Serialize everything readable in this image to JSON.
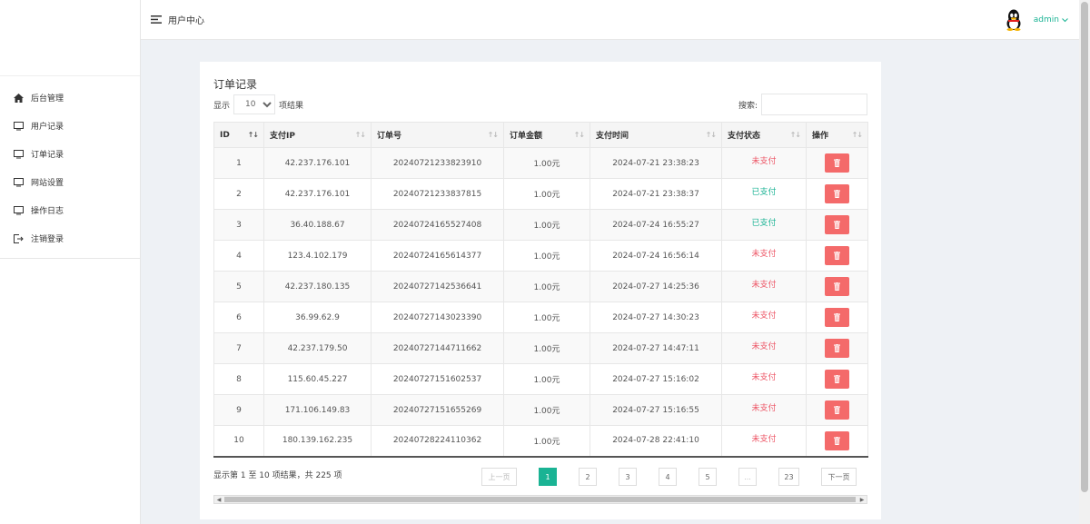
{
  "sidebar": {
    "items": [
      {
        "label": "后台管理",
        "icon": "home-icon"
      },
      {
        "label": "用户记录",
        "icon": "monitor-icon"
      },
      {
        "label": "订单记录",
        "icon": "monitor-icon"
      },
      {
        "label": "网站设置",
        "icon": "monitor-icon"
      },
      {
        "label": "操作日志",
        "icon": "monitor-icon"
      },
      {
        "label": "注销登录",
        "icon": "logout-icon"
      }
    ]
  },
  "header": {
    "title": "用户中心",
    "username": "admin",
    "avatar_icon": "qq-penguin-icon",
    "accent_color": "#1ab394"
  },
  "card": {
    "title": "订单记录",
    "length_prefix": "显示",
    "length_value": "10",
    "length_suffix": "项结果",
    "search_label": "搜索:",
    "search_value": ""
  },
  "table": {
    "columns": [
      "ID",
      "支付IP",
      "订单号",
      "订单金额",
      "支付时间",
      "支付状态",
      "操作"
    ],
    "rows": [
      {
        "id": "1",
        "ip": "42.237.176.101",
        "order_no": "20240721233823910",
        "amount": "1.00元",
        "time": "2024-07-21 23:38:23",
        "status": "未支付"
      },
      {
        "id": "2",
        "ip": "42.237.176.101",
        "order_no": "20240721233837815",
        "amount": "1.00元",
        "time": "2024-07-21 23:38:37",
        "status": "已支付"
      },
      {
        "id": "3",
        "ip": "36.40.188.67",
        "order_no": "20240724165527408",
        "amount": "1.00元",
        "time": "2024-07-24 16:55:27",
        "status": "已支付"
      },
      {
        "id": "4",
        "ip": "123.4.102.179",
        "order_no": "20240724165614377",
        "amount": "1.00元",
        "time": "2024-07-24 16:56:14",
        "status": "未支付"
      },
      {
        "id": "5",
        "ip": "42.237.180.135",
        "order_no": "20240727142536641",
        "amount": "1.00元",
        "time": "2024-07-27 14:25:36",
        "status": "未支付"
      },
      {
        "id": "6",
        "ip": "36.99.62.9",
        "order_no": "20240727143023390",
        "amount": "1.00元",
        "time": "2024-07-27 14:30:23",
        "status": "未支付"
      },
      {
        "id": "7",
        "ip": "42.237.179.50",
        "order_no": "20240727144711662",
        "amount": "1.00元",
        "time": "2024-07-27 14:47:11",
        "status": "未支付"
      },
      {
        "id": "8",
        "ip": "115.60.45.227",
        "order_no": "20240727151602537",
        "amount": "1.00元",
        "time": "2024-07-27 15:16:02",
        "status": "未支付"
      },
      {
        "id": "9",
        "ip": "171.106.149.83",
        "order_no": "20240727151655269",
        "amount": "1.00元",
        "time": "2024-07-27 15:16:55",
        "status": "未支付"
      },
      {
        "id": "10",
        "ip": "180.139.162.235",
        "order_no": "20240728224110362",
        "amount": "1.00元",
        "time": "2024-07-28 22:41:10",
        "status": "未支付"
      }
    ],
    "status_colors": {
      "未支付": "#ed5565",
      "已支付": "#1ab394"
    },
    "delete_icon": "trash-icon",
    "delete_color": "#f46a6a"
  },
  "footer": {
    "info": "显示第 1 至 10 项结果，共 225 项",
    "pager": {
      "prev": "上一页",
      "pages": [
        "1",
        "2",
        "3",
        "4",
        "5",
        "...",
        "23"
      ],
      "active": "1",
      "next": "下一页"
    }
  }
}
